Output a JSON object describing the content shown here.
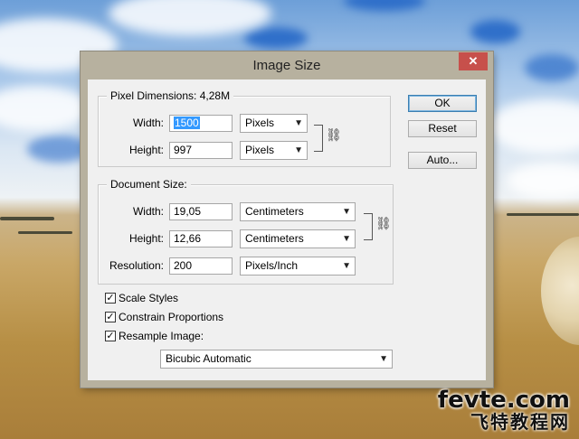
{
  "dialog": {
    "title": "Image Size",
    "close_icon": "close-icon"
  },
  "pixel_dimensions": {
    "legend": "Pixel Dimensions:",
    "size": "4,28M",
    "width_label": "Width:",
    "width_value": "1500",
    "width_unit": "Pixels",
    "height_label": "Height:",
    "height_value": "997",
    "height_unit": "Pixels",
    "link_icon": "chain-link-icon"
  },
  "document_size": {
    "legend": "Document Size:",
    "width_label": "Width:",
    "width_value": "19,05",
    "width_unit": "Centimeters",
    "height_label": "Height:",
    "height_value": "12,66",
    "height_unit": "Centimeters",
    "resolution_label": "Resolution:",
    "resolution_value": "200",
    "resolution_unit": "Pixels/Inch",
    "link_icon": "chain-link-icon"
  },
  "buttons": {
    "ok": "OK",
    "reset": "Reset",
    "auto": "Auto..."
  },
  "options": {
    "scale_styles": {
      "label": "Scale Styles",
      "checked": true
    },
    "constrain_proportions": {
      "label": "Constrain Proportions",
      "checked": true
    },
    "resample_image": {
      "label": "Resample Image:",
      "checked": true
    },
    "resample_method": "Bicubic Automatic"
  },
  "watermark": {
    "line1": "fevte.com",
    "line2": "飞特教程网"
  }
}
